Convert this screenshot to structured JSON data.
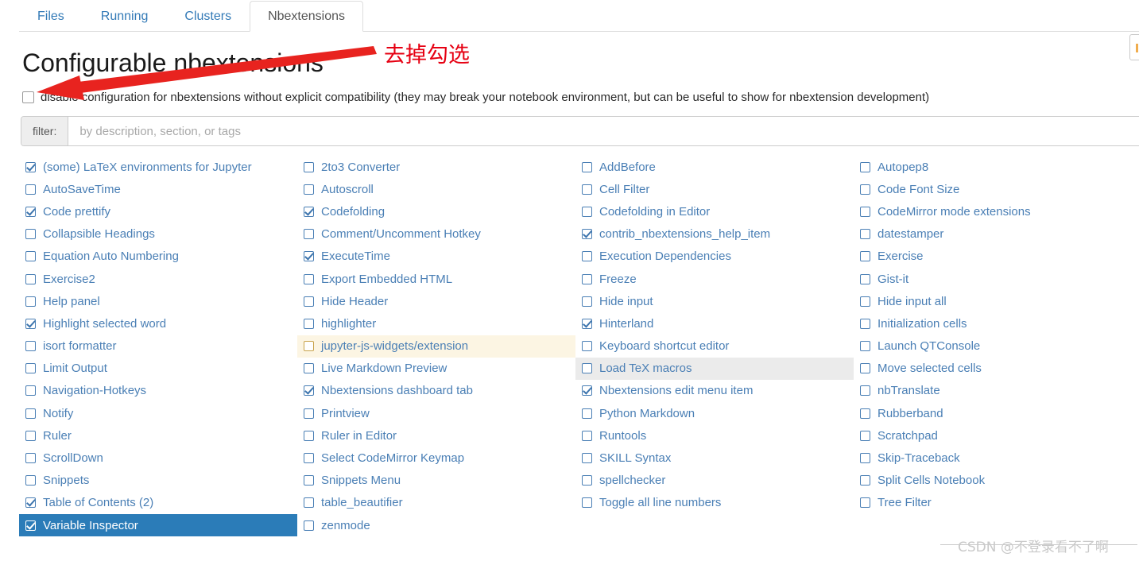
{
  "tabs": [
    {
      "label": "Files",
      "active": false
    },
    {
      "label": "Running",
      "active": false
    },
    {
      "label": "Clusters",
      "active": false
    },
    {
      "label": "Nbextensions",
      "active": true
    }
  ],
  "page": {
    "title": "Configurable nbextensions"
  },
  "disable_config": {
    "checked": false,
    "label": "disable configuration for nbextensions without explicit compatibility (they may break your notebook environment, but can be useful to show for nbextension development)"
  },
  "filter": {
    "label": "filter:",
    "value": "",
    "placeholder": "by description, section, or tags"
  },
  "annotation": {
    "text": "去掉勾选",
    "color": "#e60012"
  },
  "watermark": {
    "text": "CSDN @不登录看不了啊"
  },
  "colors": {
    "link": "#4a7fb5",
    "tab_active_text": "#555555",
    "selected_bg": "#2b7cb8",
    "warning_bg": "#fcf5e3",
    "hover_bg": "#ebebeb",
    "annotation": "#e60012"
  },
  "extensions": {
    "columns": [
      {
        "items": [
          {
            "label": "(some) LaTeX environments for Jupyter",
            "checked": true,
            "state": ""
          },
          {
            "label": "AutoSaveTime",
            "checked": false,
            "state": ""
          },
          {
            "label": "Code prettify",
            "checked": true,
            "state": ""
          },
          {
            "label": "Collapsible Headings",
            "checked": false,
            "state": ""
          },
          {
            "label": "Equation Auto Numbering",
            "checked": false,
            "state": ""
          },
          {
            "label": "Exercise2",
            "checked": false,
            "state": ""
          },
          {
            "label": "Help panel",
            "checked": false,
            "state": ""
          },
          {
            "label": "Highlight selected word",
            "checked": true,
            "state": ""
          },
          {
            "label": "isort formatter",
            "checked": false,
            "state": ""
          },
          {
            "label": "Limit Output",
            "checked": false,
            "state": ""
          },
          {
            "label": "Navigation-Hotkeys",
            "checked": false,
            "state": ""
          },
          {
            "label": "Notify",
            "checked": false,
            "state": ""
          },
          {
            "label": "Ruler",
            "checked": false,
            "state": ""
          },
          {
            "label": "ScrollDown",
            "checked": false,
            "state": ""
          },
          {
            "label": "Snippets",
            "checked": false,
            "state": ""
          },
          {
            "label": "Table of Contents (2)",
            "checked": true,
            "state": ""
          },
          {
            "label": "Variable Inspector",
            "checked": true,
            "state": "selected"
          }
        ]
      },
      {
        "items": [
          {
            "label": "2to3 Converter",
            "checked": false,
            "state": ""
          },
          {
            "label": "Autoscroll",
            "checked": false,
            "state": ""
          },
          {
            "label": "Codefolding",
            "checked": true,
            "state": ""
          },
          {
            "label": "Comment/Uncomment Hotkey",
            "checked": false,
            "state": ""
          },
          {
            "label": "ExecuteTime",
            "checked": true,
            "state": ""
          },
          {
            "label": "Export Embedded HTML",
            "checked": false,
            "state": ""
          },
          {
            "label": "Hide Header",
            "checked": false,
            "state": ""
          },
          {
            "label": "highlighter",
            "checked": false,
            "state": ""
          },
          {
            "label": "jupyter-js-widgets/extension",
            "checked": false,
            "state": "warning"
          },
          {
            "label": "Live Markdown Preview",
            "checked": false,
            "state": ""
          },
          {
            "label": "Nbextensions dashboard tab",
            "checked": true,
            "state": ""
          },
          {
            "label": "Printview",
            "checked": false,
            "state": ""
          },
          {
            "label": "Ruler in Editor",
            "checked": false,
            "state": ""
          },
          {
            "label": "Select CodeMirror Keymap",
            "checked": false,
            "state": ""
          },
          {
            "label": "Snippets Menu",
            "checked": false,
            "state": ""
          },
          {
            "label": "table_beautifier",
            "checked": false,
            "state": ""
          },
          {
            "label": "zenmode",
            "checked": false,
            "state": ""
          }
        ]
      },
      {
        "items": [
          {
            "label": "AddBefore",
            "checked": false,
            "state": ""
          },
          {
            "label": "Cell Filter",
            "checked": false,
            "state": ""
          },
          {
            "label": "Codefolding in Editor",
            "checked": false,
            "state": ""
          },
          {
            "label": "contrib_nbextensions_help_item",
            "checked": true,
            "state": ""
          },
          {
            "label": "Execution Dependencies",
            "checked": false,
            "state": ""
          },
          {
            "label": "Freeze",
            "checked": false,
            "state": ""
          },
          {
            "label": "Hide input",
            "checked": false,
            "state": ""
          },
          {
            "label": "Hinterland",
            "checked": true,
            "state": ""
          },
          {
            "label": "Keyboard shortcut editor",
            "checked": false,
            "state": ""
          },
          {
            "label": "Load TeX macros",
            "checked": false,
            "state": "hover"
          },
          {
            "label": "Nbextensions edit menu item",
            "checked": true,
            "state": ""
          },
          {
            "label": "Python Markdown",
            "checked": false,
            "state": ""
          },
          {
            "label": "Runtools",
            "checked": false,
            "state": ""
          },
          {
            "label": "SKILL Syntax",
            "checked": false,
            "state": ""
          },
          {
            "label": "spellchecker",
            "checked": false,
            "state": ""
          },
          {
            "label": "Toggle all line numbers",
            "checked": false,
            "state": ""
          }
        ]
      },
      {
        "items": [
          {
            "label": "Autopep8",
            "checked": false,
            "state": ""
          },
          {
            "label": "Code Font Size",
            "checked": false,
            "state": ""
          },
          {
            "label": "CodeMirror mode extensions",
            "checked": false,
            "state": ""
          },
          {
            "label": "datestamper",
            "checked": false,
            "state": ""
          },
          {
            "label": "Exercise",
            "checked": false,
            "state": ""
          },
          {
            "label": "Gist-it",
            "checked": false,
            "state": ""
          },
          {
            "label": "Hide input all",
            "checked": false,
            "state": ""
          },
          {
            "label": "Initialization cells",
            "checked": false,
            "state": ""
          },
          {
            "label": "Launch QTConsole",
            "checked": false,
            "state": ""
          },
          {
            "label": "Move selected cells",
            "checked": false,
            "state": ""
          },
          {
            "label": "nbTranslate",
            "checked": false,
            "state": ""
          },
          {
            "label": "Rubberband",
            "checked": false,
            "state": ""
          },
          {
            "label": "Scratchpad",
            "checked": false,
            "state": ""
          },
          {
            "label": "Skip-Traceback",
            "checked": false,
            "state": ""
          },
          {
            "label": "Split Cells Notebook",
            "checked": false,
            "state": ""
          },
          {
            "label": "Tree Filter",
            "checked": false,
            "state": ""
          }
        ]
      }
    ]
  }
}
